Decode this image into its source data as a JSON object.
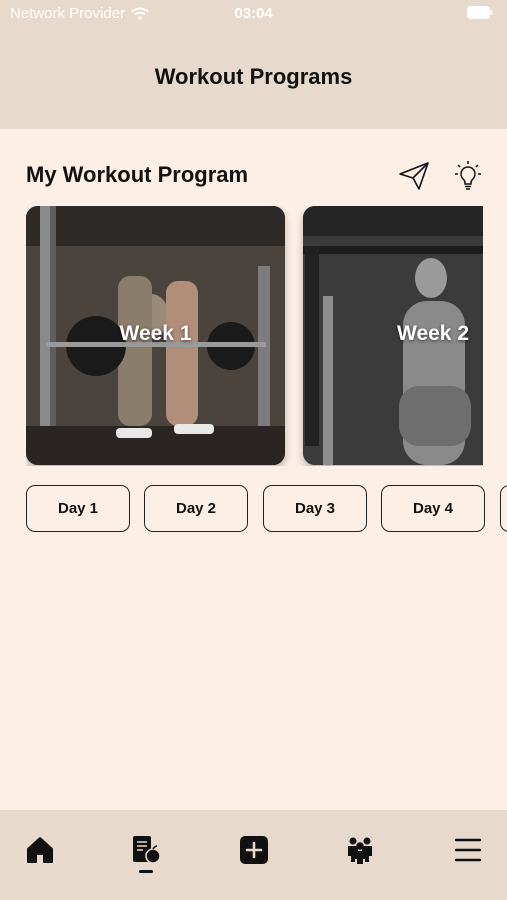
{
  "status_bar": {
    "carrier": "Network Provider",
    "time": "03:04"
  },
  "header": {
    "title": "Workout Programs"
  },
  "section": {
    "title": "My Workout Program"
  },
  "weeks": [
    {
      "label": "Week 1"
    },
    {
      "label": "Week 2"
    }
  ],
  "days": [
    {
      "label": "Day 1"
    },
    {
      "label": "Day 2"
    },
    {
      "label": "Day 3"
    },
    {
      "label": "Day 4"
    }
  ],
  "tabs": {
    "items": [
      "home-icon",
      "nutrition-icon",
      "add-icon",
      "community-icon",
      "menu-icon"
    ],
    "active": "nutrition-icon"
  },
  "colors": {
    "background": "#fbefe6",
    "header": "#e7d9cb",
    "text": "#111111"
  }
}
